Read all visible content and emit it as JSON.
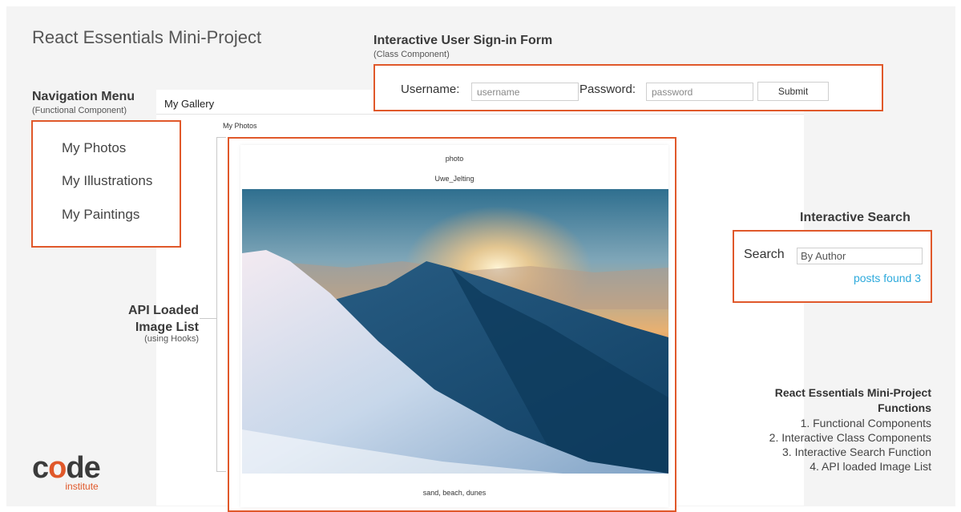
{
  "slide": {
    "title": "React Essentials Mini-Project"
  },
  "annotations": {
    "nav": {
      "title": "Navigation Menu",
      "subtitle": "(Functional Component)"
    },
    "form": {
      "title": "Interactive User Sign-in Form",
      "subtitle": "(Class Component)"
    },
    "search": {
      "title": "Interactive Search"
    },
    "api": {
      "title": "API Loaded Image List",
      "subtitle": "(using Hooks)"
    }
  },
  "app": {
    "title": "My Gallery",
    "section_label": "My Photos"
  },
  "nav_menu": {
    "items": [
      "My Photos",
      "My Illustrations",
      "My Paintings"
    ]
  },
  "signin_form": {
    "username_label": "Username:",
    "username_placeholder": "username",
    "password_label": "Password:",
    "password_placeholder": "password",
    "submit_label": "Submit"
  },
  "search": {
    "label": "Search",
    "placeholder": "By Author",
    "result_text": "posts found 3"
  },
  "image_card": {
    "type": "photo",
    "author": "Uwe_Jelting",
    "tags": "sand, beach, dunes"
  },
  "functions": {
    "title": "React Essentials Mini-Project Functions",
    "items": [
      "1. Functional Components",
      "2. Interactive Class Components",
      "3. Interactive Search Function",
      "4. API loaded Image List"
    ]
  },
  "logo": {
    "word_prefix": "c",
    "word_o": "o",
    "word_suffix": "de",
    "sub": "institute"
  },
  "colors": {
    "accent": "#e0582a",
    "link": "#2eaadc",
    "background": "#f4f4f4"
  }
}
